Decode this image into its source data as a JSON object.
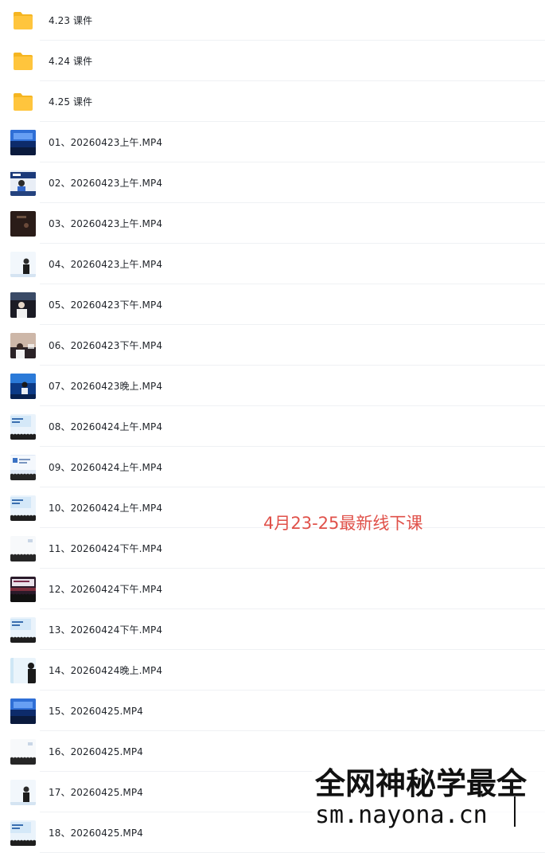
{
  "files": [
    {
      "type": "folder",
      "name": "4.23 课件",
      "icon": "folder-icon",
      "thumb": "folder"
    },
    {
      "type": "folder",
      "name": "4.24 课件",
      "icon": "folder-icon",
      "thumb": "folder"
    },
    {
      "type": "folder",
      "name": "4.25 课件",
      "icon": "folder-icon",
      "thumb": "folder"
    },
    {
      "type": "video",
      "name": "01、20260423上午.MP4",
      "icon": "video-thumbnail",
      "thumb": "stage-blue"
    },
    {
      "type": "video",
      "name": "02、20260423上午.MP4",
      "icon": "video-thumbnail",
      "thumb": "speaker-screen"
    },
    {
      "type": "video",
      "name": "03、20260423上午.MP4",
      "icon": "video-thumbnail",
      "thumb": "dark-room"
    },
    {
      "type": "video",
      "name": "04、20260423上午.MP4",
      "icon": "video-thumbnail",
      "thumb": "speaker-light"
    },
    {
      "type": "video",
      "name": "05、20260423下午.MP4",
      "icon": "video-thumbnail",
      "thumb": "speaker-dark"
    },
    {
      "type": "video",
      "name": "06、20260423下午.MP4",
      "icon": "video-thumbnail",
      "thumb": "speaker-warm"
    },
    {
      "type": "video",
      "name": "07、20260423晚上.MP4",
      "icon": "video-thumbnail",
      "thumb": "stage-blue-speaker"
    },
    {
      "type": "video",
      "name": "08、20260424上午.MP4",
      "icon": "video-thumbnail",
      "thumb": "screen-audience"
    },
    {
      "type": "video",
      "name": "09、20260424上午.MP4",
      "icon": "video-thumbnail",
      "thumb": "screen-slide"
    },
    {
      "type": "video",
      "name": "10、20260424上午.MP4",
      "icon": "video-thumbnail",
      "thumb": "screen-audience"
    },
    {
      "type": "video",
      "name": "11、20260424下午.MP4",
      "icon": "video-thumbnail",
      "thumb": "audience-white"
    },
    {
      "type": "video",
      "name": "12、20260424下午.MP4",
      "icon": "video-thumbnail",
      "thumb": "dark-hall"
    },
    {
      "type": "video",
      "name": "13、20260424下午.MP4",
      "icon": "video-thumbnail",
      "thumb": "screen-audience"
    },
    {
      "type": "video",
      "name": "14、20260424晚上.MP4",
      "icon": "video-thumbnail",
      "thumb": "speaker-side"
    },
    {
      "type": "video",
      "name": "15、20260425.MP4",
      "icon": "video-thumbnail",
      "thumb": "stage-blue"
    },
    {
      "type": "video",
      "name": "16、20260425.MP4",
      "icon": "video-thumbnail",
      "thumb": "audience-white"
    },
    {
      "type": "video",
      "name": "17、20260425.MP4",
      "icon": "video-thumbnail",
      "thumb": "speaker-light"
    },
    {
      "type": "video",
      "name": "18、20260425.MP4",
      "icon": "video-thumbnail",
      "thumb": "screen-audience"
    }
  ],
  "annotation": {
    "text": "4月23-25最新线下课",
    "color": "#e0514a"
  },
  "watermark": {
    "line1": "全网神秘学最全",
    "line2": "sm.nayona.cn"
  },
  "colors": {
    "folder": "#ffc53d",
    "folder_tab": "#f5b521",
    "divider": "#eff1f4",
    "text": "#1f2329"
  }
}
